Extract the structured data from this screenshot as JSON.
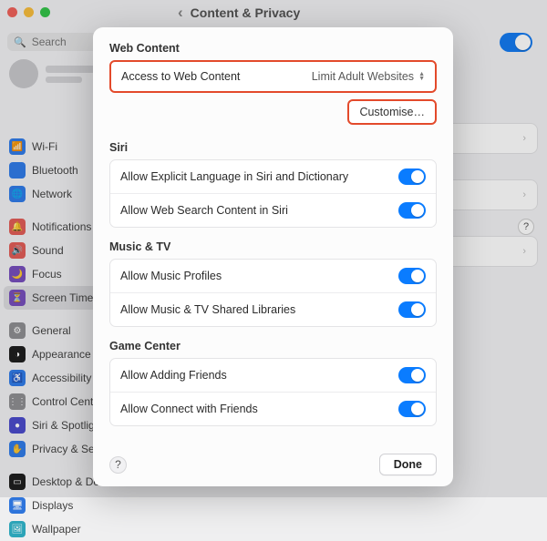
{
  "header": {
    "title": "Content & Privacy"
  },
  "search": {
    "placeholder": "Search"
  },
  "sidebar": {
    "items": [
      {
        "label": "Wi-Fi",
        "color": "#2a7cf6",
        "glyph": "📶"
      },
      {
        "label": "Bluetooth",
        "color": "#2a7cf6",
        "glyph": ""
      },
      {
        "label": "Network",
        "color": "#2a7cf6",
        "glyph": "🌐"
      },
      {
        "label": "Notifications",
        "color": "#ed5b55",
        "glyph": "🔔"
      },
      {
        "label": "Sound",
        "color": "#ed5b55",
        "glyph": "🔊"
      },
      {
        "label": "Focus",
        "color": "#7a4dc8",
        "glyph": "🌙"
      },
      {
        "label": "Screen Time",
        "color": "#7a4dc8",
        "glyph": "⏳",
        "selected": true
      },
      {
        "label": "General",
        "color": "#8e8e93",
        "glyph": "⚙"
      },
      {
        "label": "Appearance",
        "color": "#1f1f1f",
        "glyph": "◑"
      },
      {
        "label": "Accessibility",
        "color": "#2a7cf6",
        "glyph": "♿"
      },
      {
        "label": "Control Centre",
        "color": "#8e8e93",
        "glyph": "⋮⋮"
      },
      {
        "label": "Siri & Spotlight",
        "color": "#4b4bd8",
        "glyph": "●"
      },
      {
        "label": "Privacy & Security",
        "color": "#2a7cf6",
        "glyph": "✋"
      },
      {
        "label": "Desktop & Dock",
        "color": "#1f1f1f",
        "glyph": "▭"
      },
      {
        "label": "Displays",
        "color": "#2a7cf6",
        "glyph": "🖥"
      },
      {
        "label": "Wallpaper",
        "color": "#23b1c9",
        "glyph": "🖼"
      }
    ],
    "gaps_after": [
      2,
      6,
      12
    ]
  },
  "panel_rows": [],
  "modal": {
    "sections": [
      {
        "title": "Web Content",
        "highlight": true,
        "rows": [
          {
            "label": "Access to Web Content",
            "type": "select",
            "value": "Limit Adult Websites"
          }
        ],
        "customise": "Customise…"
      },
      {
        "title": "Siri",
        "rows": [
          {
            "label": "Allow Explicit Language in Siri and Dictionary",
            "type": "toggle",
            "on": true
          },
          {
            "label": "Allow Web Search Content in Siri",
            "type": "toggle",
            "on": true
          }
        ]
      },
      {
        "title": "Music & TV",
        "rows": [
          {
            "label": "Allow Music Profiles",
            "type": "toggle",
            "on": true
          },
          {
            "label": "Allow Music & TV Shared Libraries",
            "type": "toggle",
            "on": true
          }
        ]
      },
      {
        "title": "Game Center",
        "rows": [
          {
            "label": "Allow Adding Friends",
            "type": "toggle",
            "on": true
          },
          {
            "label": "Allow Connect with Friends",
            "type": "toggle",
            "on": true
          }
        ]
      }
    ],
    "help": "?",
    "done": "Done"
  }
}
